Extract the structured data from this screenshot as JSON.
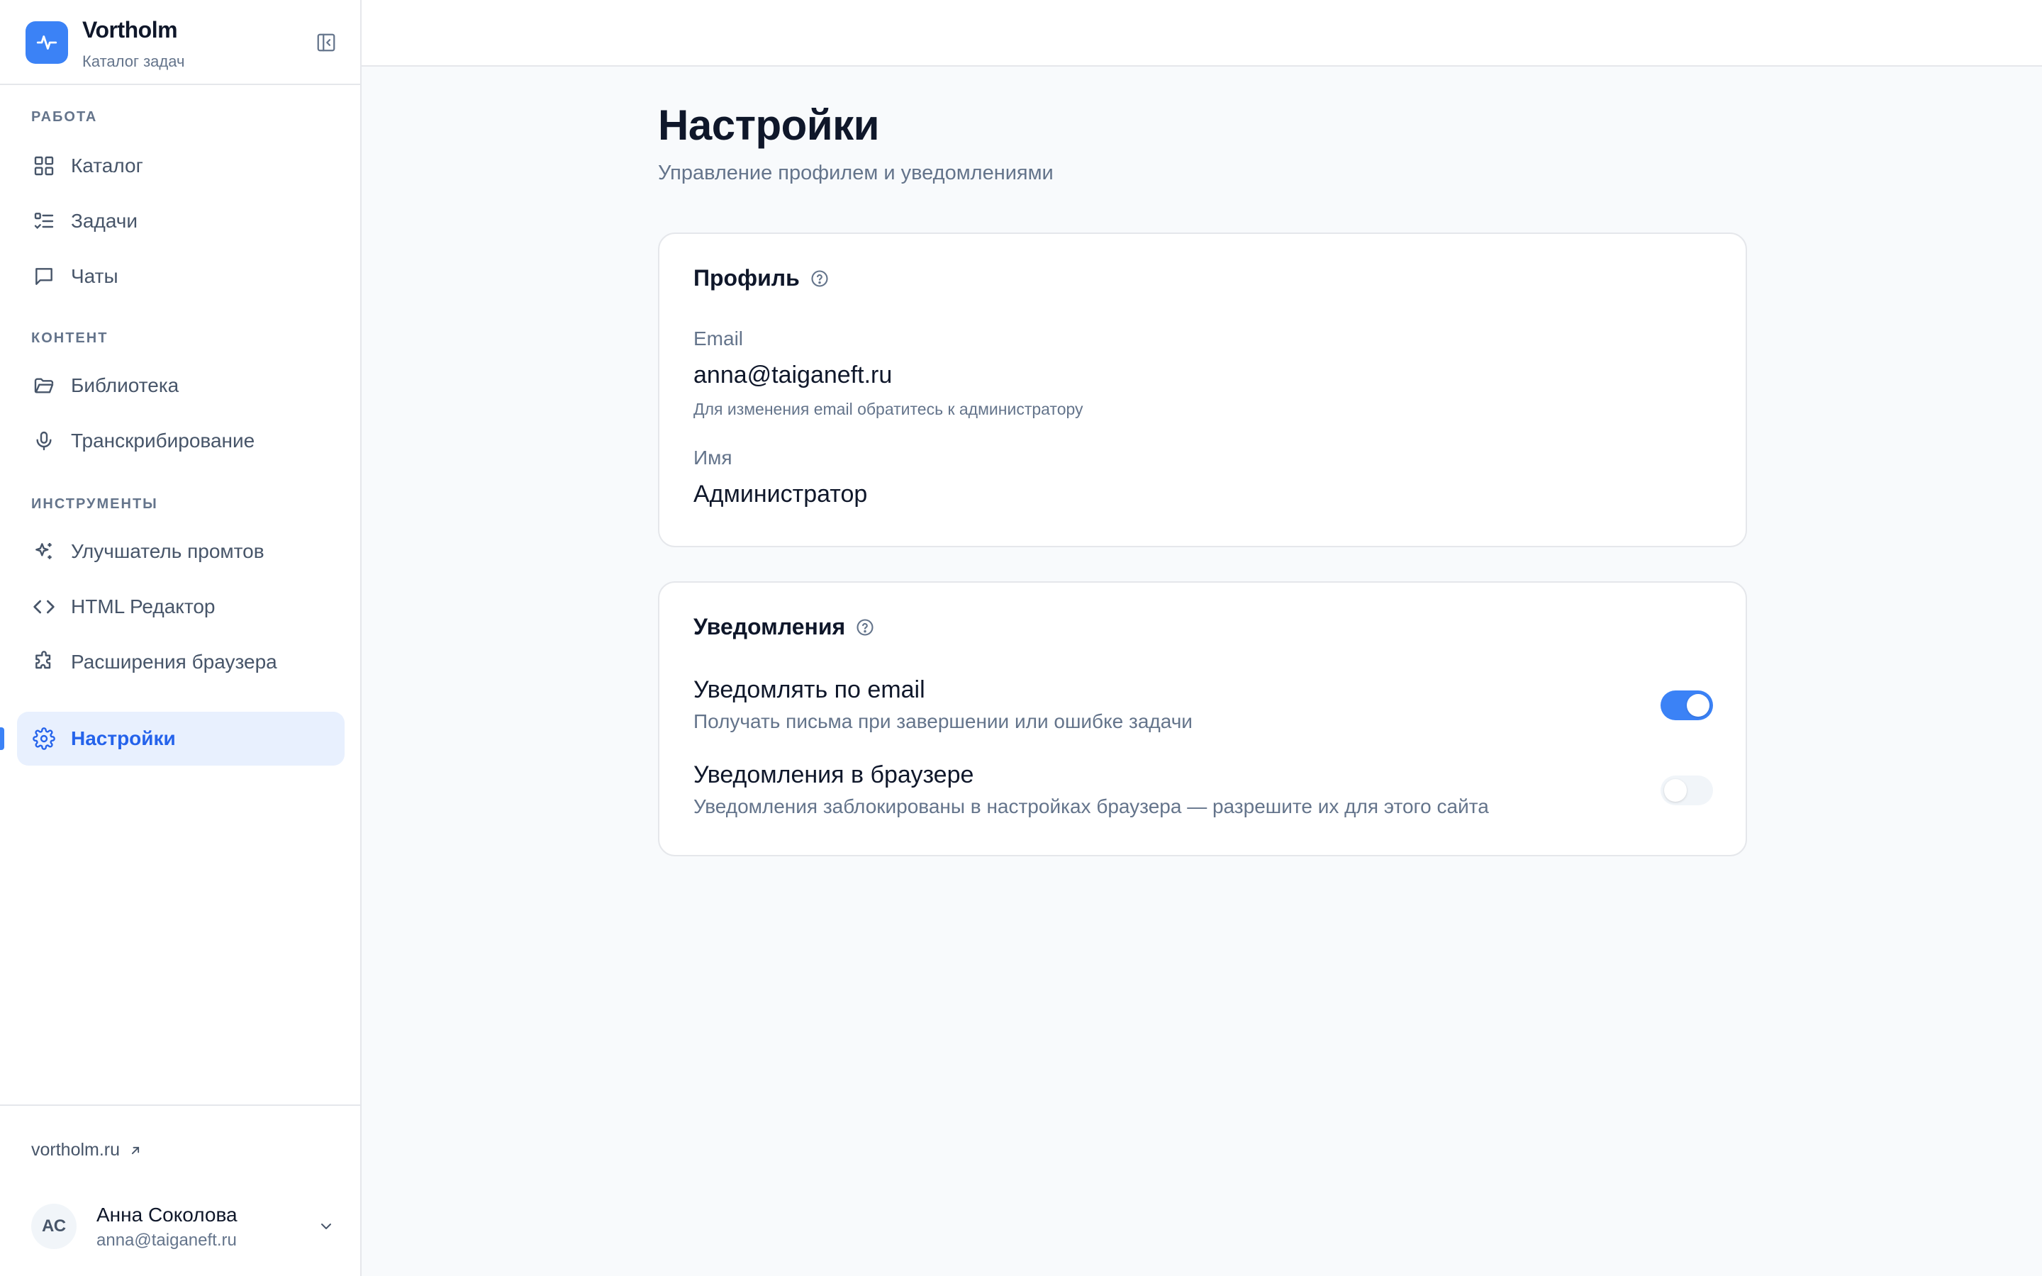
{
  "brand": {
    "name": "Vortholm",
    "subtitle": "Каталог задач"
  },
  "sidebar": {
    "sections": [
      {
        "title": "РАБОТА",
        "items": [
          {
            "label": "Каталог",
            "icon": "grid-icon"
          },
          {
            "label": "Задачи",
            "icon": "list-checks-icon"
          },
          {
            "label": "Чаты",
            "icon": "chat-bubble-icon"
          }
        ]
      },
      {
        "title": "КОНТЕНТ",
        "items": [
          {
            "label": "Библиотека",
            "icon": "folder-open-icon"
          },
          {
            "label": "Транскрибирование",
            "icon": "microphone-icon"
          }
        ]
      },
      {
        "title": "ИНСТРУМЕНТЫ",
        "items": [
          {
            "label": "Улучшатель промтов",
            "icon": "sparkles-icon"
          },
          {
            "label": "HTML Редактор",
            "icon": "code-brackets-icon"
          },
          {
            "label": "Расширения браузера",
            "icon": "puzzle-icon"
          }
        ]
      }
    ],
    "settings_item": {
      "label": "Настройки",
      "icon": "gear-icon",
      "active": true
    },
    "footer": {
      "link": "vortholm.ru",
      "user": {
        "initials": "АС",
        "name": "Анна Соколова",
        "email": "anna@taiganeft.ru"
      }
    }
  },
  "page": {
    "title": "Настройки",
    "subtitle": "Управление профилем и уведомлениями"
  },
  "profile": {
    "title": "Профиль",
    "email_label": "Email",
    "email_value": "anna@taiganeft.ru",
    "email_hint": "Для изменения email обратитесь к администратору",
    "name_label": "Имя",
    "name_value": "Администратор"
  },
  "notifications": {
    "title": "Уведомления",
    "items": [
      {
        "title": "Уведомлять по email",
        "description": "Получать письма при завершении или ошибке задачи",
        "enabled": true
      },
      {
        "title": "Уведомления в браузере",
        "description": "Уведомления заблокированы в настройках браузера — разрешите их для этого сайта",
        "enabled": false
      }
    ]
  },
  "colors": {
    "accent": "#3b82f6",
    "active_bg": "#e8f0fe",
    "text_primary": "#0f172a",
    "text_muted": "#64748b"
  }
}
